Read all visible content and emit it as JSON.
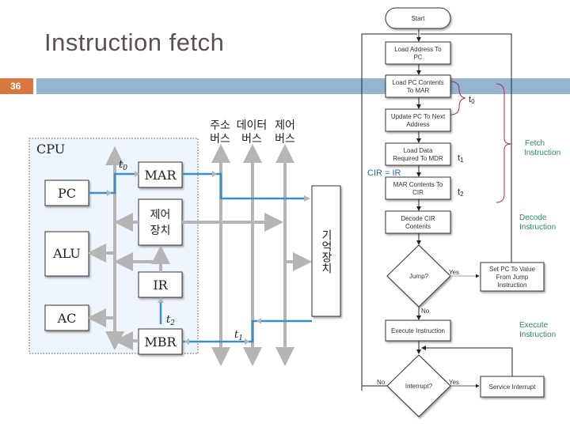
{
  "slide": {
    "title": "Instruction fetch",
    "number": "36",
    "colors": {
      "accent_orange": "#d9783e",
      "header_bar": "#94b4cf",
      "bus_gray": "#b5b5b5",
      "active_blue": "#3a8fc4",
      "brace_red": "#a0304a",
      "note_green": "#2e8b57"
    }
  },
  "cpu_diagram": {
    "cpu_label": "CPU",
    "registers": {
      "pc": "PC",
      "mar": "MAR",
      "alu": "ALU",
      "ac": "AC",
      "ir": "IR",
      "mbr": "MBR"
    },
    "control_unit": [
      "제어",
      "장치"
    ],
    "buses": [
      {
        "line1": "주소",
        "line2": "버스"
      },
      {
        "line1": "데이터",
        "line2": "버스"
      },
      {
        "line1": "제어",
        "line2": "버스"
      }
    ],
    "memory": "기억장치",
    "timing": {
      "t0": "t",
      "t0_sub": "0",
      "t1": "t",
      "t1_sub": "1",
      "t2": "t",
      "t2_sub": "2"
    }
  },
  "flowchart": {
    "start": "Start",
    "steps": [
      [
        "Load Address To",
        "PC"
      ],
      [
        "Load PC Contents",
        "To MAR"
      ],
      [
        "Update PC To Next",
        "Address"
      ],
      [
        "Load Data",
        "Required To MDR"
      ],
      [
        "MAR Contents To",
        "CIR"
      ],
      [
        "Decode CIR",
        "Contents"
      ],
      [
        "Execute Instruction"
      ]
    ],
    "jump_decision": "Jump?",
    "jump_yes": "Yes",
    "jump_no": "No",
    "set_pc": [
      "Set PC To Value",
      "From Jump",
      "Instruction"
    ],
    "interrupt_decision": "Interrupt?",
    "interrupt_yes": "Yes",
    "interrupt_no": "No",
    "service_interrupt": "Service Interrupt",
    "annotations": {
      "t0": "t",
      "t0_sub": "0",
      "t1": "t",
      "t1_sub": "1",
      "t2": "t",
      "t2_sub": "2",
      "cir_ir": "CIR = IR",
      "fetch": [
        "Fetch",
        "Instruction"
      ],
      "decode": [
        "Decode",
        "Instruction"
      ],
      "execute": [
        "Execute",
        "Instruction"
      ]
    }
  }
}
